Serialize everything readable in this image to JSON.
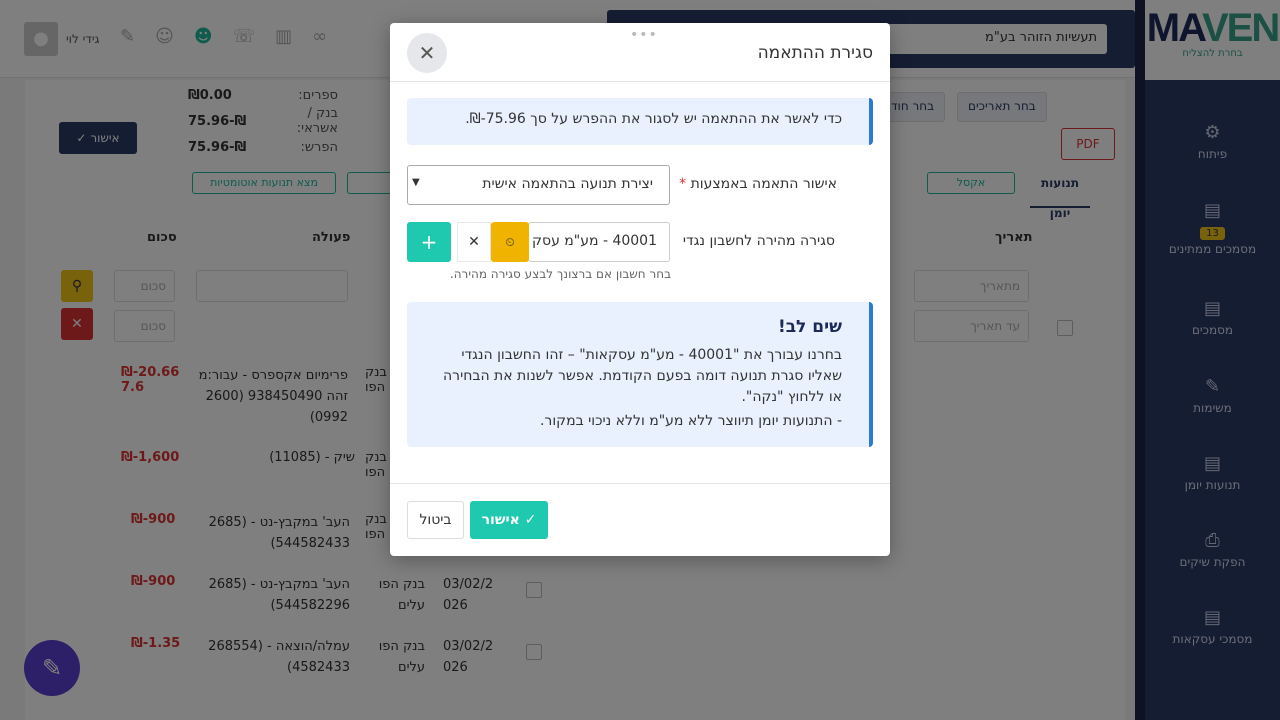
{
  "app": {
    "company": "תעשיות הזוהר בע\"מ",
    "user_name": "גידי לוי",
    "logo_text": "MAVEN",
    "logo_tagline": "בחרת להצליח"
  },
  "sidebar": {
    "items": [
      {
        "label": "פיתוח",
        "icon": "⚙"
      },
      {
        "label": "מסמכים ממתינים",
        "icon": "▤",
        "badge": "13"
      },
      {
        "label": "מסמכים",
        "icon": "▤"
      },
      {
        "label": "משימות",
        "icon": "✎"
      },
      {
        "label": "תנועות יומן",
        "icon": "▤"
      },
      {
        "label": "הפקת שיקים",
        "icon": "⎙"
      },
      {
        "label": "מסמכי עסקאות",
        "icon": "▤"
      }
    ]
  },
  "summary": {
    "books_label": "ספרים:",
    "books_value": "₪0.00",
    "bank_label": "בנק / אשראי:",
    "bank_value": "₪-75.96",
    "diff_label": "הפרש:",
    "diff_value": "₪-75.96",
    "approve_label": "אישור"
  },
  "toolbar": {
    "pdf": "PDF",
    "dates_btn": "בחר תאריכים",
    "month_btn": "בחר חוד",
    "tab_journal": "תנועות יומן",
    "excel": "אקסל",
    "auto": "מצא תנועות אוטומטיות"
  },
  "table": {
    "headers": {
      "date": "תאריך",
      "action": "פעולה",
      "amount": "סכום"
    },
    "filters": {
      "from_date": "מתאריך",
      "to_date": "עד תאריך",
      "amount_from": "סכום",
      "amount_to": "סכום"
    },
    "rows": [
      {
        "action": "פרימיום אקספרס - עבור:מ זהה 938450490 (2600 0992)",
        "amount": "₪-20.66 7.6",
        "bank": "בנק הפו"
      },
      {
        "action": "שיק - (11085)",
        "amount": "₪-1,600",
        "bank": "בנק הפו"
      },
      {
        "action": "העב' במקבץ-נט - (2685 544582433)",
        "amount": "₪-900",
        "bank": "בנק הפו"
      },
      {
        "action": "העב' במקבץ-נט - (2685 544582296)",
        "amount": "₪-900",
        "bank": "בנק הפו עלים",
        "date": "03/02/2 026"
      },
      {
        "action": "עמלה/הוצאה - (268554 4582433)",
        "amount": "₪-1.35",
        "bank": "בנק הפו עלים",
        "date": "03/02/2 026"
      }
    ]
  },
  "modal": {
    "title": "סגירת ההתאמה",
    "drag": "•••",
    "close_icon": "✕",
    "info": "כדי לאשר את ההתאמה יש לסגור את ההפרש על סך 75.96-₪.",
    "approve_via_label": "אישור התאמה באמצעות",
    "required_mark": "*",
    "approve_via_value": "יצירת תנועה בהתאמה אישית",
    "quick_close_label": "סגירה מהירה לחשבון נגדי",
    "account_value": "40001 - מע\"מ עסק",
    "history_icon": "⏲",
    "clear_icon": "✕",
    "add_icon": "+",
    "help": "בחר חשבון אם ברצונך לבצע סגירה מהירה.",
    "notice_title": "שים לב!",
    "notice_text": "בחרנו עבורך את \"40001 - מע\"מ עסקאות\" – זהו החשבון הנגדי שאליו סגרת תנועה דומה בפעם הקודמת. אפשר לשנות את הבחירה או ללחוץ \"נקה\".",
    "notice_sub": "- התנועות יומן תיווצר ללא מע\"מ וללא ניכוי במקור.",
    "cancel": "ביטול",
    "ok": "אישור",
    "ok_icon": "✓"
  }
}
